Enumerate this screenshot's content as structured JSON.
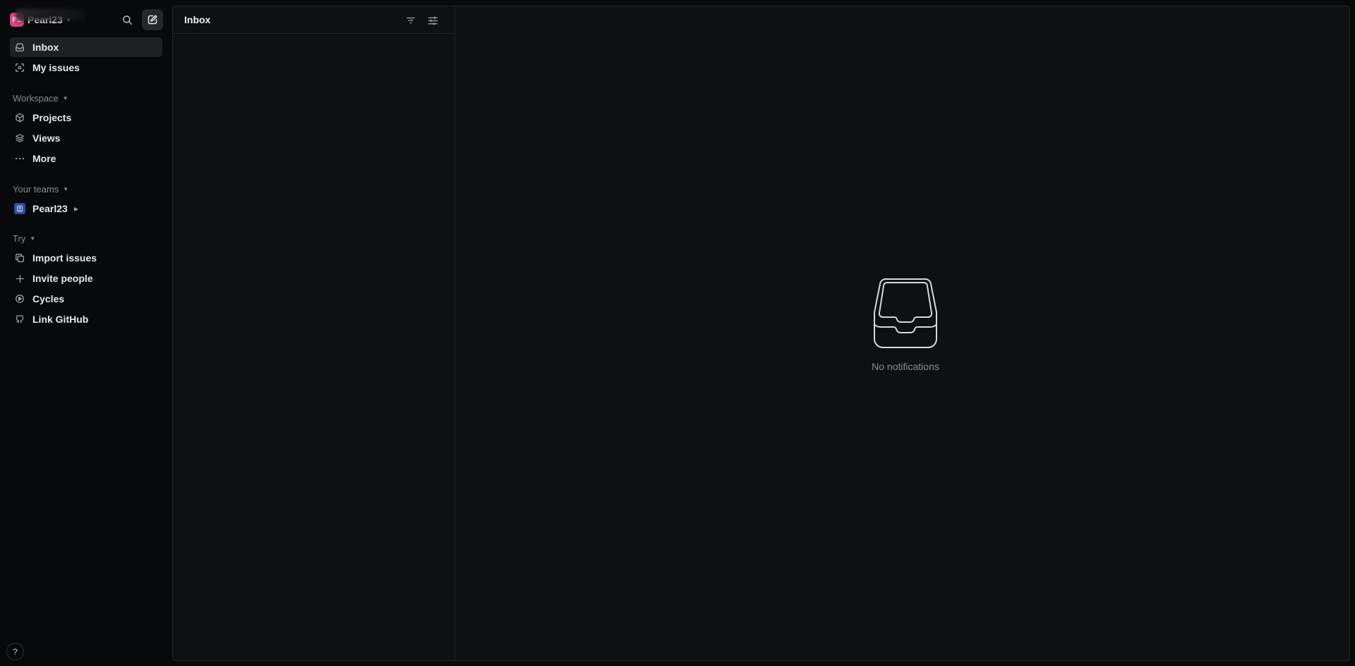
{
  "workspace": {
    "name": "Pearl23",
    "logo_initials": "PE"
  },
  "header": {
    "search_icon": "search-icon",
    "compose_icon": "compose-icon"
  },
  "nav": {
    "primary": [
      {
        "label": "Inbox",
        "icon": "inbox-icon",
        "active": true
      },
      {
        "label": "My issues",
        "icon": "my-issues-icon",
        "active": false
      }
    ],
    "workspace_label": "Workspace",
    "workspace_items": [
      {
        "label": "Projects",
        "icon": "cube-icon"
      },
      {
        "label": "Views",
        "icon": "layers-icon"
      },
      {
        "label": "More",
        "icon": "more-icon"
      }
    ],
    "teams_label": "Your teams",
    "teams": [
      {
        "label": "Pearl23",
        "icon": "team-icon"
      }
    ],
    "try_label": "Try",
    "try_items": [
      {
        "label": "Import issues",
        "icon": "import-icon"
      },
      {
        "label": "Invite people",
        "icon": "plus-icon"
      },
      {
        "label": "Cycles",
        "icon": "cycles-icon"
      },
      {
        "label": "Link GitHub",
        "icon": "github-icon"
      }
    ]
  },
  "help": {
    "label": "?"
  },
  "inbox": {
    "title": "Inbox",
    "empty_message": "No notifications"
  },
  "colors": {
    "background": "#08090a",
    "panel": "#0f1012",
    "border": "#232428",
    "active_item": "#1f2023",
    "brand": "#e8478f",
    "team": "#2e4b9c"
  }
}
